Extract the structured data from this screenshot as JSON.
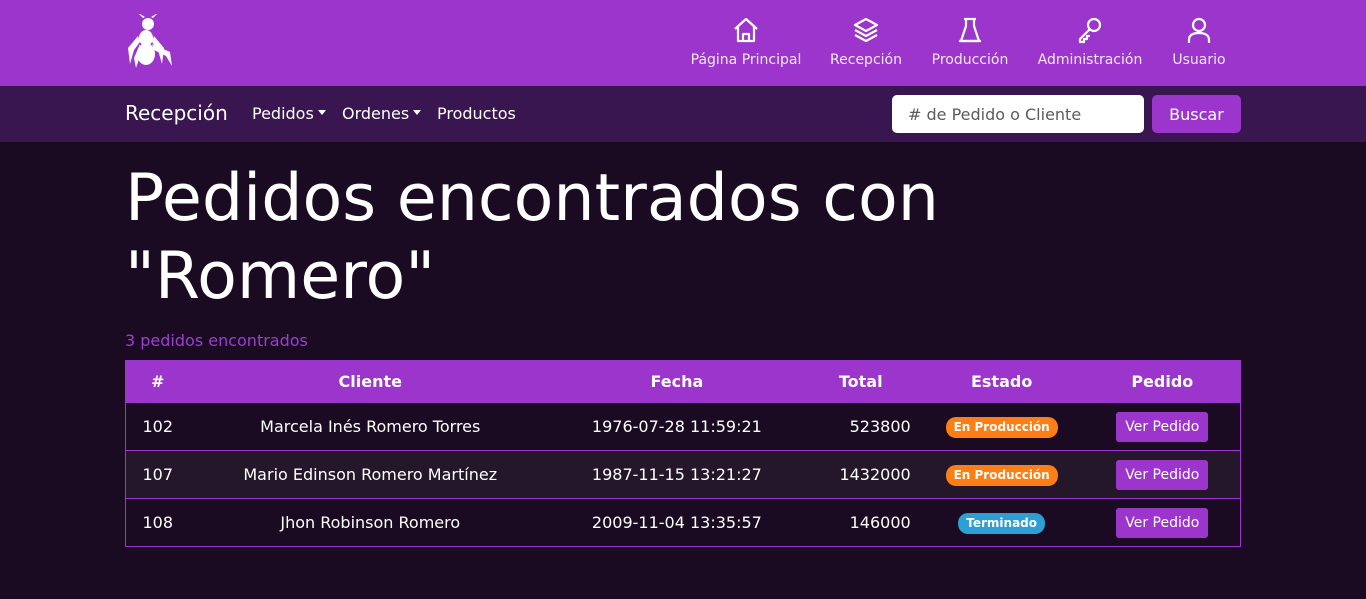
{
  "brand": {
    "logo_icon": "ant-icon"
  },
  "nav": [
    {
      "label": "Página Principal",
      "icon": "home-icon"
    },
    {
      "label": "Recepción",
      "icon": "layers-icon"
    },
    {
      "label": "Producción",
      "icon": "flask-icon"
    },
    {
      "label": "Administración",
      "icon": "key-icon"
    },
    {
      "label": "Usuario",
      "icon": "user-icon"
    }
  ],
  "subnav": {
    "section": "Recepción",
    "links": [
      {
        "label": "Pedidos",
        "dropdown": true
      },
      {
        "label": "Ordenes",
        "dropdown": true
      },
      {
        "label": "Productos",
        "dropdown": false
      }
    ],
    "search_placeholder": "# de Pedido o Cliente",
    "search_button": "Buscar"
  },
  "main": {
    "title": "Pedidos encontrados con \"Romero\"",
    "count_text": "3 pedidos encontrados",
    "columns": [
      "#",
      "Cliente",
      "Fecha",
      "Total",
      "Estado",
      "Pedido"
    ],
    "rows": [
      {
        "num": "102",
        "cliente": "Marcela Inés Romero Torres",
        "fecha": "1976-07-28 11:59:21",
        "total": "523800",
        "estado": "En Producción",
        "accion": "Ver Pedido"
      },
      {
        "num": "107",
        "cliente": "Mario Edinson Romero Martínez",
        "fecha": "1987-11-15 13:21:27",
        "total": "1432000",
        "estado": "En Producción",
        "accion": "Ver Pedido"
      },
      {
        "num": "108",
        "cliente": "Jhon Robinson Romero",
        "fecha": "2009-11-04 13:35:57",
        "total": "146000",
        "estado": "Terminado",
        "accion": "Ver Pedido"
      }
    ]
  },
  "colors": {
    "accent": "#9b35cc",
    "subbar": "#3a1650",
    "background": "#1a0b22",
    "status_en_produccion": "#fd7e14",
    "status_terminado": "#2d9fd4"
  }
}
